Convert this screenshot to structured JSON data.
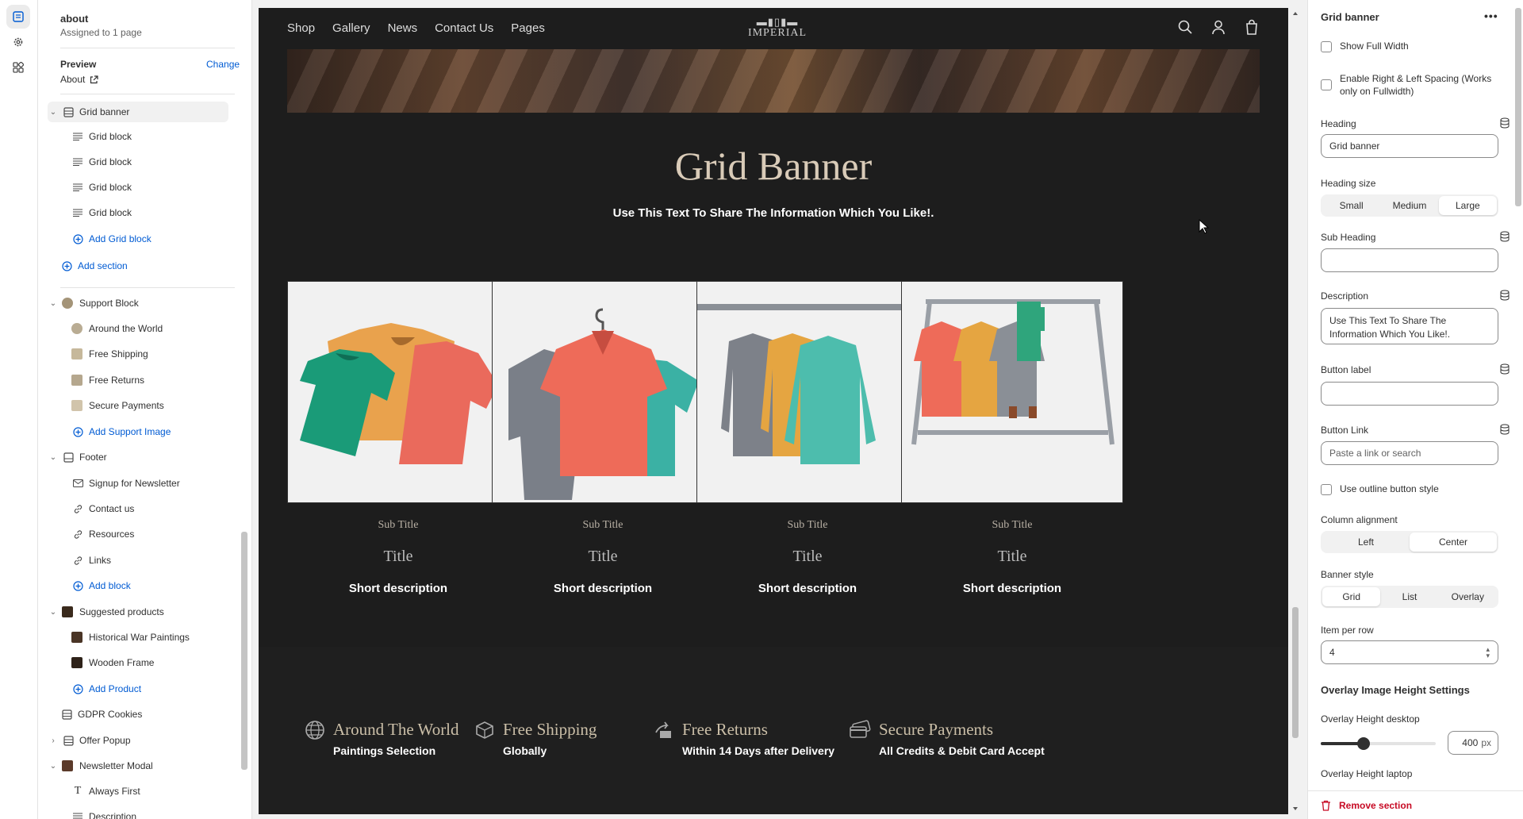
{
  "template": {
    "name": "about",
    "assigned": "Assigned to 1 page"
  },
  "preview": {
    "label": "Preview",
    "change": "Change",
    "value": "About"
  },
  "tree": {
    "grid_banner": "Grid banner",
    "grid_blocks": [
      "Grid block",
      "Grid block",
      "Grid block",
      "Grid block"
    ],
    "add_grid_block": "Add Grid block",
    "add_section": "Add section",
    "support_block": "Support Block",
    "support_items": [
      "Around the World",
      "Free Shipping",
      "Free Returns",
      "Secure Payments"
    ],
    "add_support_image": "Add Support Image",
    "footer": "Footer",
    "footer_items": [
      "Signup for Newsletter",
      "Contact us",
      "Resources",
      "Links"
    ],
    "add_block": "Add block",
    "suggested_products": "Suggested products",
    "product_items": [
      "Historical War Paintings",
      "Wooden Frame"
    ],
    "add_product": "Add Product",
    "gdpr": "GDPR Cookies",
    "offer_popup": "Offer Popup",
    "newsletter_modal": "Newsletter Modal",
    "newsletter_items": [
      "Always First",
      "Description"
    ]
  },
  "store": {
    "nav": [
      "Shop",
      "Gallery",
      "News",
      "Contact Us",
      "Pages"
    ],
    "logo": "IMPERIAL",
    "banner_title": "Grid Banner",
    "banner_desc": "Use This Text To Share The Information Which You Like!.",
    "cards": [
      {
        "sub": "Sub Title",
        "title": "Title",
        "desc": "Short description"
      },
      {
        "sub": "Sub Title",
        "title": "Title",
        "desc": "Short description"
      },
      {
        "sub": "Sub Title",
        "title": "Title",
        "desc": "Short description"
      },
      {
        "sub": "Sub Title",
        "title": "Title",
        "desc": "Short description"
      }
    ],
    "support": [
      {
        "title": "Around The World",
        "desc": "Paintings Selection"
      },
      {
        "title": "Free Shipping",
        "desc": "Globally"
      },
      {
        "title": "Free Returns",
        "desc": "Within 14 Days after Delivery"
      },
      {
        "title": "Secure Payments",
        "desc": "All Credits & Debit Card Accept"
      }
    ]
  },
  "settings": {
    "title": "Grid banner",
    "show_full_width": "Show Full Width",
    "enable_spacing": "Enable Right & Left Spacing (Works only on Fullwidth)",
    "heading_label": "Heading",
    "heading_value": "Grid banner",
    "heading_size_label": "Heading size",
    "heading_sizes": [
      "Small",
      "Medium",
      "Large"
    ],
    "heading_size_selected": "Large",
    "sub_heading_label": "Sub Heading",
    "sub_heading_value": "",
    "description_label": "Description",
    "description_value": "Use This Text To Share The Information Which You Like!.",
    "button_label_label": "Button label",
    "button_label_value": "",
    "button_link_label": "Button Link",
    "button_link_placeholder": "Paste a link or search",
    "outline_button": "Use outline button style",
    "column_alignment_label": "Column alignment",
    "column_alignments": [
      "Left",
      "Center"
    ],
    "column_alignment_selected": "Center",
    "banner_style_label": "Banner style",
    "banner_styles": [
      "Grid",
      "List",
      "Overlay"
    ],
    "banner_style_selected": "Grid",
    "item_per_row_label": "Item per row",
    "item_per_row_value": "4",
    "overlay_heading": "Overlay Image Height Settings",
    "overlay_desktop_label": "Overlay Height desktop",
    "overlay_desktop_value": "400",
    "overlay_unit": "px",
    "overlay_laptop_label": "Overlay Height laptop",
    "remove_section": "Remove section"
  },
  "colors": {
    "accent": "#005bd3",
    "danger": "#c70a24",
    "store_bg": "#1d1d1d",
    "heading_gold": "#d9cbb8"
  }
}
